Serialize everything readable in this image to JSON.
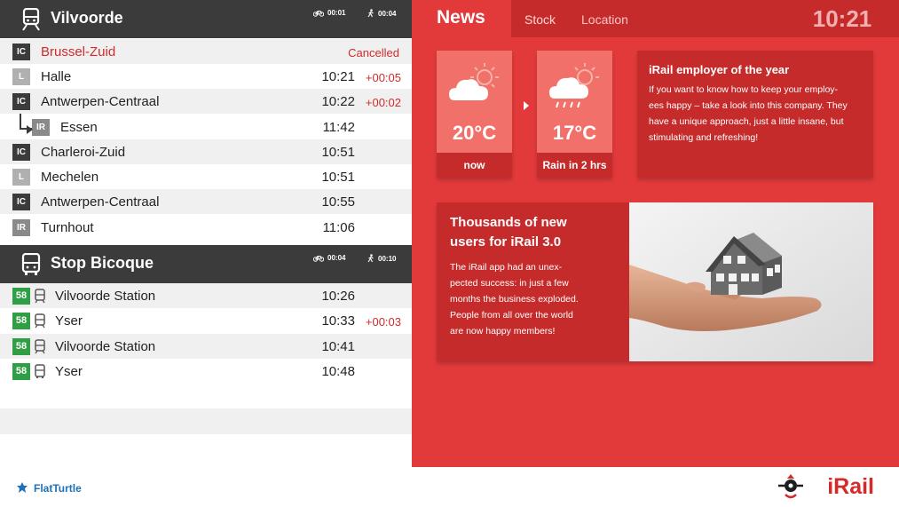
{
  "colors": {
    "accent_red": "#e23a3a",
    "dark_red": "#c62b2b",
    "header_dark": "#3b3b3b",
    "delay_red": "#d42a2a",
    "bus_green": "#2f9e44",
    "flatturtle_blue": "#1e70b8"
  },
  "train_board": {
    "station": "Vilvoorde",
    "icon": "train-icon",
    "bike_time": "00:01",
    "walk_time": "00:04",
    "departures": [
      {
        "type": "IC",
        "destination": "Brussel-Zuid",
        "time": "",
        "delay": "",
        "status": "Cancelled"
      },
      {
        "type": "L",
        "destination": "Halle",
        "time": "10:21",
        "delay": "+00:05",
        "status": ""
      },
      {
        "type": "IC",
        "destination": "Antwerpen-Centraal",
        "time": "10:22",
        "delay": "+00:02",
        "status": ""
      },
      {
        "type": "IR",
        "destination": "Essen",
        "time": "11:42",
        "delay": "",
        "status": ""
      },
      {
        "type": "IC",
        "destination": "Charleroi-Zuid",
        "time": "10:51",
        "delay": "",
        "status": ""
      },
      {
        "type": "L",
        "destination": "Mechelen",
        "time": "10:51",
        "delay": "",
        "status": ""
      },
      {
        "type": "IC",
        "destination": "Antwerpen-Centraal",
        "time": "10:55",
        "delay": "",
        "status": ""
      },
      {
        "type": "IR",
        "destination": "Turnhout",
        "time": "11:06",
        "delay": "",
        "status": ""
      }
    ]
  },
  "bus_board": {
    "station": "Stop Bicoque",
    "icon": "bus-icon",
    "bike_time": "00:04",
    "walk_time": "00:10",
    "departures": [
      {
        "line": "58",
        "destination": "Vilvoorde Station",
        "time": "10:26",
        "delay": ""
      },
      {
        "line": "58",
        "destination": "Yser",
        "time": "10:33",
        "delay": "+00:03"
      },
      {
        "line": "58",
        "destination": "Vilvoorde Station",
        "time": "10:41",
        "delay": ""
      },
      {
        "line": "58",
        "destination": "Yser",
        "time": "10:48",
        "delay": ""
      }
    ]
  },
  "tabs": {
    "active": "News",
    "items": [
      "Stock",
      "Location"
    ]
  },
  "clock": "10:21",
  "weather": [
    {
      "temp": "20°C",
      "label": "now",
      "icon": "partly-cloudy-icon"
    },
    {
      "temp": "17°C",
      "label": "Rain in 2 hrs",
      "icon": "rain-cloud-icon"
    }
  ],
  "news": [
    {
      "title": "iRail employer of the year",
      "lines": [
        "If you want to know how to keep your employ-",
        "ees happy – take a look into this company.  They",
        "have a unique approach, just a little insane, but",
        "stimulating and refreshing!"
      ]
    },
    {
      "title_lines": [
        "Thousands of new",
        "users for iRail 3.0"
      ],
      "lines": [
        "The iRail app had an unex-",
        "pected success: in just a few",
        "months the business exploded.",
        "People from all over the world",
        "are now happy members!"
      ],
      "image": "house-in-hand-photo"
    }
  ],
  "footer": {
    "left_brand": "FlatTurtle",
    "right_brand": "iRail"
  }
}
